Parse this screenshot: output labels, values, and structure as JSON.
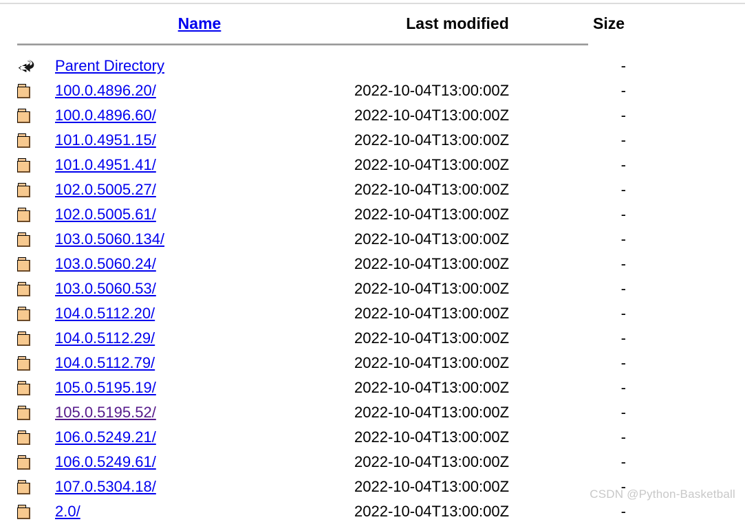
{
  "page": {
    "type": "apache-directory-index",
    "watermark": "CSDN @Python-Basketball"
  },
  "columns": {
    "name": "Name",
    "last_modified": "Last modified",
    "size": "Size",
    "description": ""
  },
  "parent": {
    "label": "Parent Directory",
    "icon": "back-arrow-icon",
    "last_modified": "",
    "size": "-"
  },
  "colors": {
    "link": "#0000EE",
    "visited_link": "#551A8B",
    "text": "#000000",
    "rule": "#9A9A9A",
    "watermark": "#C8C8C8",
    "folder_icon_fill": "#F7C98F",
    "background": "#FFFFFF"
  },
  "entries": [
    {
      "name": "100.0.4896.20/",
      "last_modified": "2022-10-04T13:00:00Z",
      "size": "-",
      "icon": "folder-icon",
      "visited": false
    },
    {
      "name": "100.0.4896.60/",
      "last_modified": "2022-10-04T13:00:00Z",
      "size": "-",
      "icon": "folder-icon",
      "visited": false
    },
    {
      "name": "101.0.4951.15/",
      "last_modified": "2022-10-04T13:00:00Z",
      "size": "-",
      "icon": "folder-icon",
      "visited": false
    },
    {
      "name": "101.0.4951.41/",
      "last_modified": "2022-10-04T13:00:00Z",
      "size": "-",
      "icon": "folder-icon",
      "visited": false
    },
    {
      "name": "102.0.5005.27/",
      "last_modified": "2022-10-04T13:00:00Z",
      "size": "-",
      "icon": "folder-icon",
      "visited": false
    },
    {
      "name": "102.0.5005.61/",
      "last_modified": "2022-10-04T13:00:00Z",
      "size": "-",
      "icon": "folder-icon",
      "visited": false
    },
    {
      "name": "103.0.5060.134/",
      "last_modified": "2022-10-04T13:00:00Z",
      "size": "-",
      "icon": "folder-icon",
      "visited": false
    },
    {
      "name": "103.0.5060.24/",
      "last_modified": "2022-10-04T13:00:00Z",
      "size": "-",
      "icon": "folder-icon",
      "visited": false
    },
    {
      "name": "103.0.5060.53/",
      "last_modified": "2022-10-04T13:00:00Z",
      "size": "-",
      "icon": "folder-icon",
      "visited": false
    },
    {
      "name": "104.0.5112.20/",
      "last_modified": "2022-10-04T13:00:00Z",
      "size": "-",
      "icon": "folder-icon",
      "visited": false
    },
    {
      "name": "104.0.5112.29/",
      "last_modified": "2022-10-04T13:00:00Z",
      "size": "-",
      "icon": "folder-icon",
      "visited": false
    },
    {
      "name": "104.0.5112.79/",
      "last_modified": "2022-10-04T13:00:00Z",
      "size": "-",
      "icon": "folder-icon",
      "visited": false
    },
    {
      "name": "105.0.5195.19/",
      "last_modified": "2022-10-04T13:00:00Z",
      "size": "-",
      "icon": "folder-icon",
      "visited": false
    },
    {
      "name": "105.0.5195.52/",
      "last_modified": "2022-10-04T13:00:00Z",
      "size": "-",
      "icon": "folder-icon",
      "visited": true
    },
    {
      "name": "106.0.5249.21/",
      "last_modified": "2022-10-04T13:00:00Z",
      "size": "-",
      "icon": "folder-icon",
      "visited": false
    },
    {
      "name": "106.0.5249.61/",
      "last_modified": "2022-10-04T13:00:00Z",
      "size": "-",
      "icon": "folder-icon",
      "visited": false
    },
    {
      "name": "107.0.5304.18/",
      "last_modified": "2022-10-04T13:00:00Z",
      "size": "-",
      "icon": "folder-icon",
      "visited": false
    },
    {
      "name": "2.0/",
      "last_modified": "2022-10-04T13:00:00Z",
      "size": "-",
      "icon": "folder-icon",
      "visited": false
    }
  ]
}
